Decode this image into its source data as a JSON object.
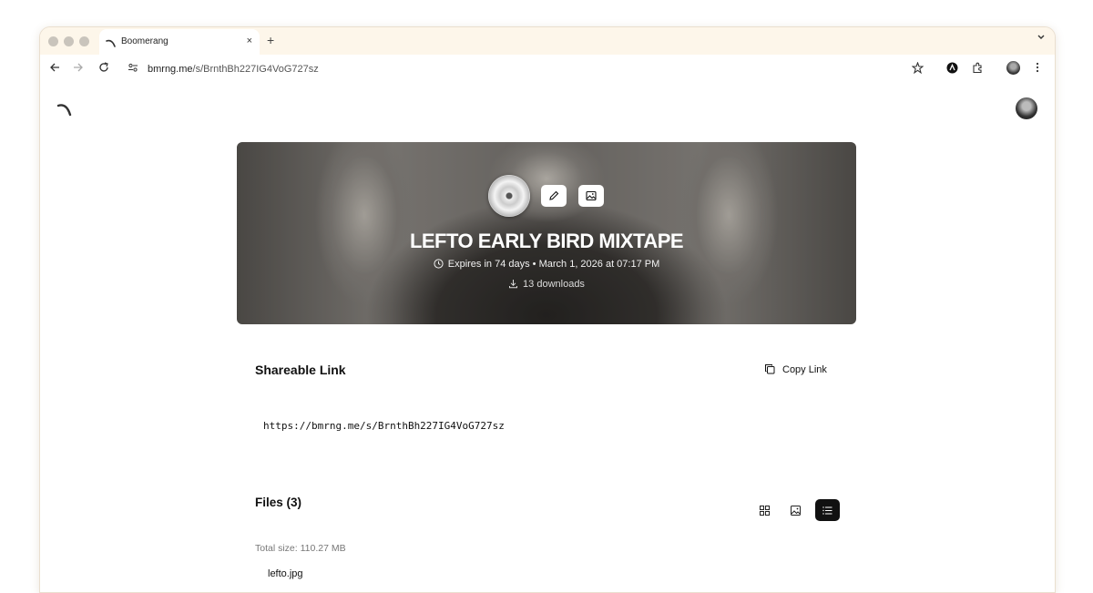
{
  "browser": {
    "tab_title": "Boomerang",
    "close_symbol": "×",
    "new_tab_symbol": "+",
    "url_host": "bmrng.me",
    "url_path": "/s/BrnthBh227IG4VoG727sz"
  },
  "hero": {
    "title": "LEFTO EARLY BIRD MIXTAPE",
    "expires_text": "Expires in 74 days • March 1, 2026 at 07:17 PM",
    "downloads_text": "13 downloads"
  },
  "share": {
    "heading": "Shareable Link",
    "copy_label": "Copy Link",
    "link": "https://bmrng.me/s/BrnthBh227IG4VoG727sz"
  },
  "files": {
    "heading": "Files (3)",
    "total_size": "Total size: 110.27 MB",
    "first_file": "lefto.jpg",
    "active_view": "list"
  },
  "icons": {
    "back": "arrow-left-icon",
    "forward": "arrow-right-icon",
    "reload": "reload-icon",
    "site_settings": "site-settings-icon",
    "bookmark": "star-icon",
    "extensions": "puzzle-icon",
    "menu": "kebab-menu-icon",
    "edit": "pencil-icon",
    "image": "image-icon",
    "clock": "clock-icon",
    "download": "download-icon",
    "copy": "copy-icon",
    "grid_view": "grid-view-icon",
    "gallery_view": "gallery-view-icon",
    "list_view": "list-view-icon"
  }
}
